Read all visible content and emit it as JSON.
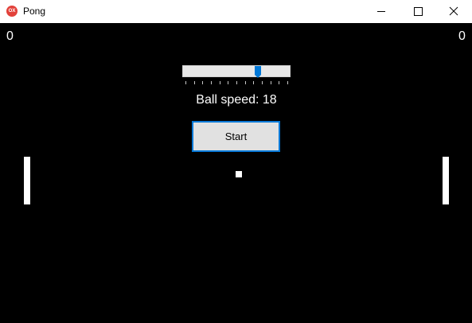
{
  "window": {
    "title": "Pong",
    "icon_text": "OX",
    "icon_color": "#e2413a",
    "controls": [
      "minimize-icon",
      "maximize-icon",
      "close-icon"
    ]
  },
  "scores": {
    "left": "0",
    "right": "0"
  },
  "speed_slider": {
    "value": 18,
    "min": 1,
    "max": 25,
    "tick_count": 13,
    "accent": "#0078d7"
  },
  "speed_label": "Ball speed: 18",
  "start_button": {
    "label": "Start"
  },
  "colors": {
    "background": "#000000",
    "foreground": "#ffffff"
  }
}
